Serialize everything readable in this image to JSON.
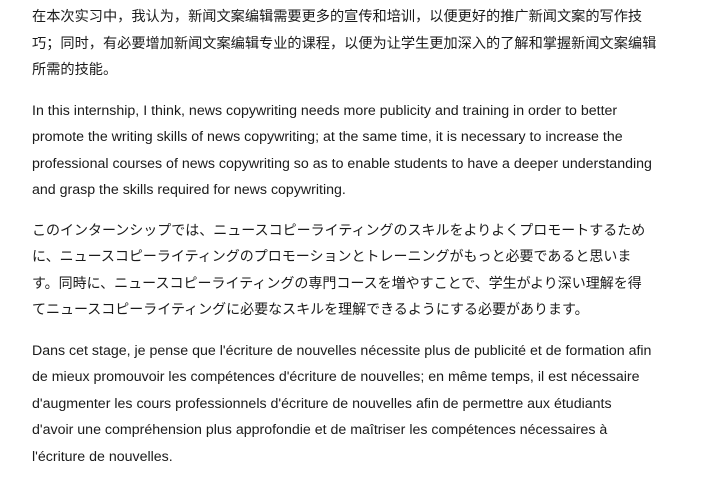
{
  "document": {
    "paragraphs": {
      "zh": "在本次实习中，我认为，新闻文案编辑需要更多的宣传和培训，以便更好的推广新闻文案的写作技\n巧；同时，有必要增加新闻文案编辑专业的课程，以便为让学生更加深入的了解和掌握新闻文案编辑\n所需的技能。",
      "en": "In this internship, I think, news copywriting needs more publicity and training in order to better\npromote the writing skills of news copywriting; at the same time, it is necessary to increase the\nprofessional courses of news copywriting so as to enable students to have a deeper understanding\nand grasp the skills required for news copywriting.",
      "ja": "このインターンシップでは、ニュースコピーライティングのスキルをよりよくプロモートするため\nに、ニュースコピーライティングのプロモーションとトレーニングがもっと必要であると思いま\nす。同時に、ニュースコピーライティングの専門コースを増やすことで、学生がより深い理解を得\nてニュースコピーライティングに必要なスキルを理解できるようにする必要があります。",
      "fr": "Dans cet stage, je pense que l'écriture de nouvelles nécessite plus de publicité et de formation afin\nde mieux promouvoir les compétences d'écriture de nouvelles; en même temps, il est nécessaire\nd'augmenter les cours professionnels d'écriture de nouvelles afin de permettre aux étudiants\nd'avoir une compréhension plus approfondie et de maîtriser les compétences nécessaires à\nl'écriture de nouvelles."
    }
  }
}
